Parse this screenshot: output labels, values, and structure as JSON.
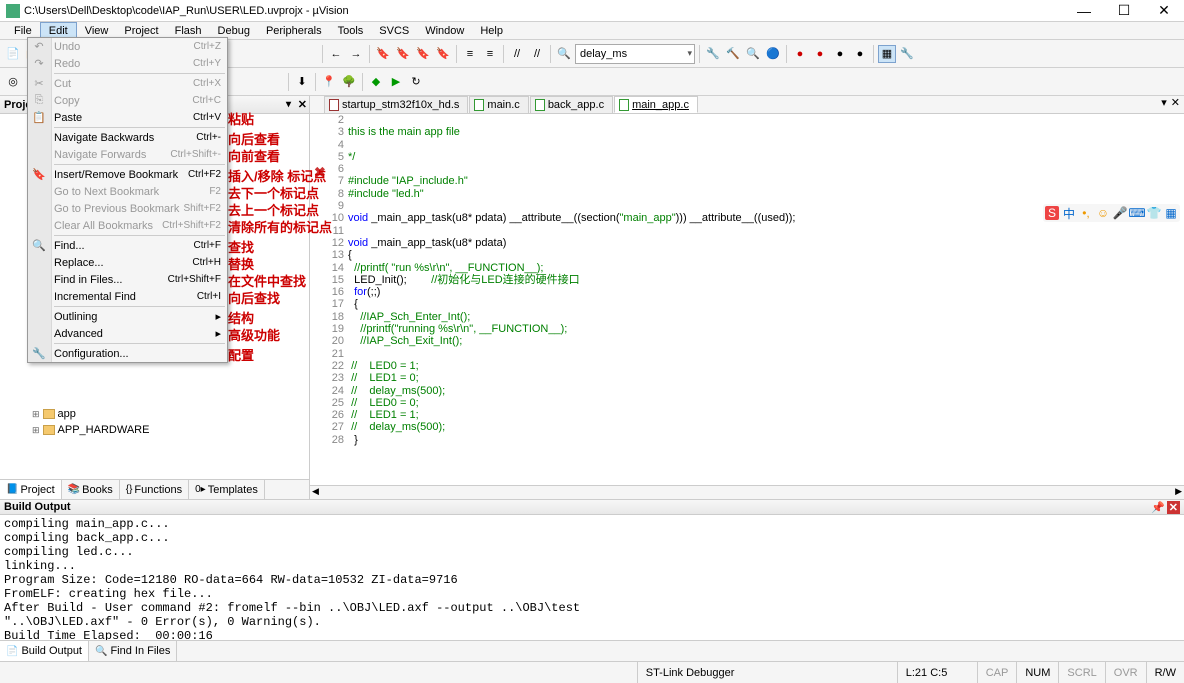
{
  "title": "C:\\Users\\Dell\\Desktop\\code\\IAP_Run\\USER\\LED.uvprojx - µVision",
  "menubar": [
    "File",
    "Edit",
    "View",
    "Project",
    "Flash",
    "Debug",
    "Peripherals",
    "Tools",
    "SVCS",
    "Window",
    "Help"
  ],
  "editmenu": [
    {
      "icon": "↶",
      "label": "Undo",
      "sc": "Ctrl+Z",
      "d": true,
      "annot": ""
    },
    {
      "icon": "↷",
      "label": "Redo",
      "sc": "Ctrl+Y",
      "d": true,
      "annot": ""
    },
    {
      "sep": 1
    },
    {
      "icon": "✂",
      "label": "Cut",
      "sc": "Ctrl+X",
      "d": true,
      "annot": ""
    },
    {
      "icon": "⎘",
      "label": "Copy",
      "sc": "Ctrl+C",
      "d": true,
      "annot": ""
    },
    {
      "icon": "📋",
      "label": "Paste",
      "sc": "Ctrl+V",
      "annot": "粘贴"
    },
    {
      "sep": 1
    },
    {
      "icon": "",
      "label": "Navigate Backwards",
      "sc": "Ctrl+-",
      "annot": "向后查看"
    },
    {
      "icon": "",
      "label": "Navigate Forwards",
      "sc": "Ctrl+Shift+-",
      "d": true,
      "annot": "向前查看"
    },
    {
      "sep": 1
    },
    {
      "icon": "🔖",
      "label": "Insert/Remove Bookmark",
      "sc": "Ctrl+F2",
      "annot": "插入/移除 标记点"
    },
    {
      "icon": "",
      "label": "Go to Next Bookmark",
      "sc": "F2",
      "d": true,
      "annot": "去下一个标记点"
    },
    {
      "icon": "",
      "label": "Go to Previous Bookmark",
      "sc": "Shift+F2",
      "d": true,
      "annot": "去上一个标记点"
    },
    {
      "icon": "",
      "label": "Clear All Bookmarks",
      "sc": "Ctrl+Shift+F2",
      "d": true,
      "annot": "清除所有的标记点"
    },
    {
      "sep": 1
    },
    {
      "icon": "🔍",
      "label": "Find...",
      "sc": "Ctrl+F",
      "annot": "查找"
    },
    {
      "icon": "",
      "label": "Replace...",
      "sc": "Ctrl+H",
      "annot": "替换"
    },
    {
      "icon": "",
      "label": "Find in Files...",
      "sc": "Ctrl+Shift+F",
      "annot": "在文件中查找"
    },
    {
      "icon": "",
      "label": "Incremental Find",
      "sc": "Ctrl+I",
      "annot": "向后查找"
    },
    {
      "sep": 1
    },
    {
      "icon": "",
      "label": "Outlining",
      "arrow": true,
      "annot": "结构"
    },
    {
      "icon": "",
      "label": "Advanced",
      "arrow": true,
      "annot": "高级功能"
    },
    {
      "sep": 1
    },
    {
      "icon": "🔧",
      "label": "Configuration...",
      "annot": "配置"
    }
  ],
  "projpanel": {
    "title": "Projec",
    "item": "APP_HARDWARE"
  },
  "projtree_visible": [
    {
      "indent": 1,
      "icon": "folder",
      "label": "app"
    },
    {
      "indent": 1,
      "icon": "folder",
      "label": "APP_HARDWARE"
    }
  ],
  "projtabs": [
    {
      "label": "Project",
      "active": true,
      "icon": "📘"
    },
    {
      "label": "Books",
      "icon": "📚"
    },
    {
      "label": "Functions",
      "icon": "{}"
    },
    {
      "label": "Templates",
      "icon": "0▸"
    }
  ],
  "edittabs": [
    {
      "label": "startup_stm32f10x_hd.s",
      "icon": "asm"
    },
    {
      "label": "main.c",
      "icon": "c"
    },
    {
      "label": "back_app.c",
      "icon": "c"
    },
    {
      "label": "main_app.c",
      "icon": "c",
      "active": true
    }
  ],
  "code": [
    {
      "n": 2,
      "t": ""
    },
    {
      "n": 3,
      "t": "this is the main app file",
      "cls": "c-green"
    },
    {
      "n": 4,
      "t": ""
    },
    {
      "n": 5,
      "t": "*/",
      "cls": "c-green"
    },
    {
      "n": 6,
      "t": ""
    },
    {
      "n": 7,
      "html": "<span class='c-green'>#include</span> <span class='c-green'>\"IAP_include.h\"</span>"
    },
    {
      "n": 8,
      "html": "<span class='c-green'>#include</span> <span class='c-green'>\"led.h\"</span>"
    },
    {
      "n": 9,
      "t": ""
    },
    {
      "n": 10,
      "html": "<span class='c-blue'>void</span> _main_app_task(u8* pdata) __attribute__((section(<span class='c-green'>\"main_app\"</span>))) __attribute__((used));"
    },
    {
      "n": 11,
      "t": ""
    },
    {
      "n": 12,
      "html": "<span class='c-blue'>void</span> _main_app_task(u8* pdata)"
    },
    {
      "n": 13,
      "t": "{"
    },
    {
      "n": 14,
      "html": "  <span class='c-green'>//printf( \"run %s\\r\\n\", __FUNCTION__);</span>"
    },
    {
      "n": 15,
      "html": "  LED_Init();        <span class='c-green'>//初始化与LED连接的硬件接口</span>"
    },
    {
      "n": 16,
      "html": "  <span class='c-blue'>for</span>(;;)"
    },
    {
      "n": 17,
      "t": "  {"
    },
    {
      "n": 18,
      "html": "    <span class='c-green'>//IAP_Sch_Enter_Int();</span>"
    },
    {
      "n": 19,
      "html": "    <span class='c-green'>//printf(\"running %s\\r\\n\", __FUNCTION__);</span>"
    },
    {
      "n": 20,
      "html": "    <span class='c-green'>//IAP_Sch_Exit_Int();</span>"
    },
    {
      "n": 21,
      "t": ""
    },
    {
      "n": 22,
      "html": " <span class='c-green'>//    LED0 = 1;</span>"
    },
    {
      "n": 23,
      "html": " <span class='c-green'>//    LED1 = 0;</span>"
    },
    {
      "n": 24,
      "html": " <span class='c-green'>//    delay_ms(500);</span>"
    },
    {
      "n": 25,
      "html": " <span class='c-green'>//    LED0 = 0;</span>"
    },
    {
      "n": 26,
      "html": " <span class='c-green'>//    LED1 = 1;</span>"
    },
    {
      "n": 27,
      "html": " <span class='c-green'>//    delay_ms(500);</span>"
    },
    {
      "n": 28,
      "t": "  }"
    }
  ],
  "toolbar_combo": "delay_ms",
  "buildhead": "Build Output",
  "buildout": "compiling main_app.c...\ncompiling back_app.c...\ncompiling led.c...\nlinking...\nProgram Size: Code=12180 RO-data=664 RW-data=10532 ZI-data=9716\nFromELF: creating hex file...\nAfter Build - User command #2: fromelf --bin ..\\OBJ\\LED.axf --output ..\\OBJ\\test\n\"..\\OBJ\\LED.axf\" - 0 Error(s), 0 Warning(s).\nBuild Time Elapsed:  00:00:16",
  "buildtabs": [
    {
      "label": "Build Output",
      "active": true,
      "icon": "📄"
    },
    {
      "label": "Find In Files",
      "icon": "🔍"
    }
  ],
  "status": {
    "debugger": "ST-Link Debugger",
    "pos": "L:21 C:5",
    "caps": "CAP",
    "num": "NUM",
    "scrl": "SCRL",
    "ovr": "OVR",
    "rw": "R/W"
  },
  "annot_x": "✖"
}
